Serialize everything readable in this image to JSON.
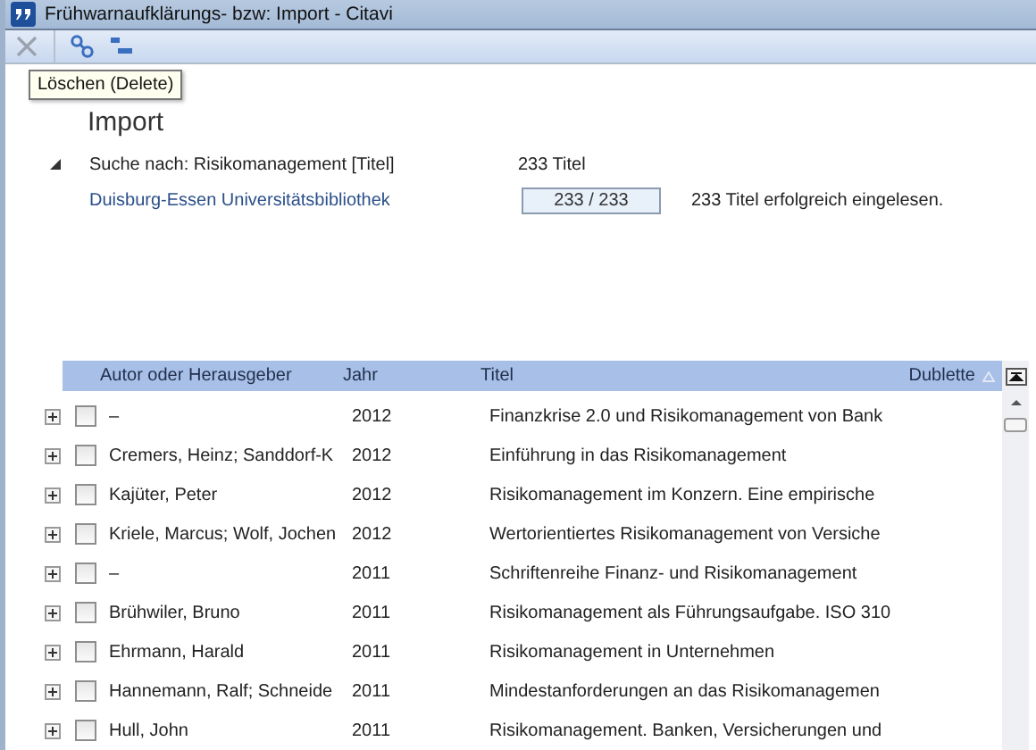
{
  "window": {
    "title": "Frühwarnaufklärungs- bzw: Import - Citavi"
  },
  "toolbar": {
    "tooltip": "Löschen (Delete)"
  },
  "heading": "Import",
  "search": {
    "expanded": true,
    "label": "Suche nach: Risikomanagement [Titel]",
    "count": "233 Titel",
    "source": "Duisburg-Essen Universitätsbibliothek",
    "progress": {
      "level": 1,
      "reading": "233 / 233"
    },
    "status": "233 Titel erfolgreich eingelesen."
  },
  "table": {
    "columns": [
      "Autor oder Herausgeber",
      "Jahr",
      "Titel",
      "Dublette"
    ],
    "rows": [
      {
        "expanded": false,
        "checked": false,
        "author": "–",
        "year": "2012",
        "title": "Finanzkrise 2.0 und Risikomanagement von Bank"
      },
      {
        "expanded": false,
        "checked": false,
        "author": "Cremers, Heinz; Sanddorf-K",
        "year": "2012",
        "title": "Einführung in das Risikomanagement"
      },
      {
        "expanded": false,
        "checked": false,
        "author": "Kajüter, Peter",
        "year": "2012",
        "title": "Risikomanagement im Konzern. Eine empirische"
      },
      {
        "expanded": false,
        "checked": false,
        "author": "Kriele, Marcus; Wolf, Jochen",
        "year": "2012",
        "title": "Wertorientiertes Risikomanagement von Versiche"
      },
      {
        "expanded": false,
        "checked": false,
        "author": "–",
        "year": "2011",
        "title": "Schriftenreihe Finanz- und Risikomanagement"
      },
      {
        "expanded": false,
        "checked": false,
        "author": "Brühwiler, Bruno",
        "year": "2011",
        "title": "Risikomanagement als Führungsaufgabe. ISO 310"
      },
      {
        "expanded": false,
        "checked": false,
        "author": "Ehrmann, Harald",
        "year": "2011",
        "title": "Risikomanagement in Unternehmen"
      },
      {
        "expanded": false,
        "checked": false,
        "author": "Hannemann, Ralf; Schneide",
        "year": "2011",
        "title": "Mindestanforderungen an das Risikomanagemen"
      },
      {
        "expanded": false,
        "checked": false,
        "author": "Hull, John",
        "year": "2011",
        "title": "Risikomanagement. Banken, Versicherungen und"
      }
    ]
  }
}
